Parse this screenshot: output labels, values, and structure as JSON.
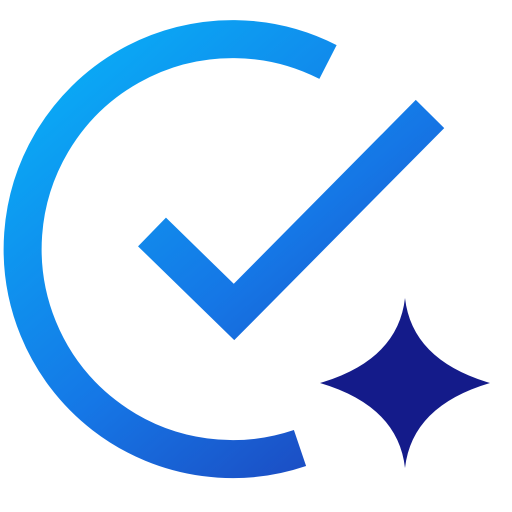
{
  "icon": {
    "name": "checkmark-sparkle-logo",
    "parts": [
      "arc-c-shape",
      "checkmark",
      "four-point-star"
    ]
  },
  "colors": {
    "gradient_start": "#0aa8f5",
    "gradient_mid": "#1577e6",
    "gradient_end": "#1e3fb8",
    "star": "#141b8a",
    "background": "#ffffff"
  }
}
